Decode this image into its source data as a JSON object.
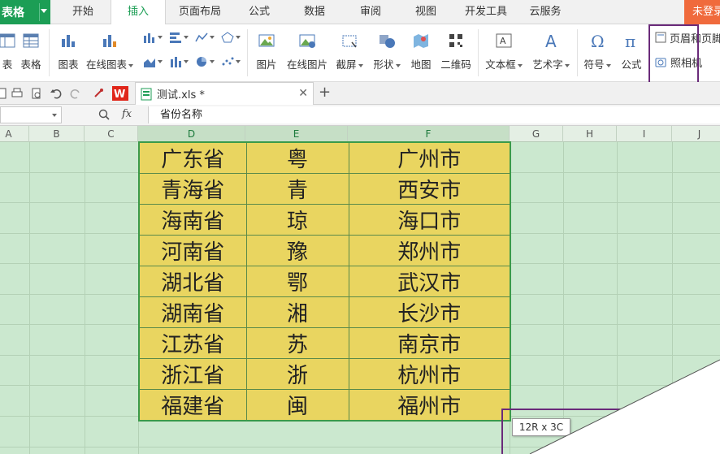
{
  "app": {
    "name": "表格",
    "login": "未登录"
  },
  "menu_tabs": [
    {
      "label": "开始"
    },
    {
      "label": "插入"
    },
    {
      "label": "页面布局"
    },
    {
      "label": "公式"
    },
    {
      "label": "数据"
    },
    {
      "label": "审阅"
    },
    {
      "label": "视图"
    },
    {
      "label": "开发工具"
    },
    {
      "label": "云服务"
    }
  ],
  "active_tab": "插入",
  "ribbon": {
    "pivot_table": "表",
    "table": "表格",
    "chart": "图表",
    "online_chart": "在线图表",
    "picture": "图片",
    "online_picture": "在线图片",
    "screenshot": "截屏",
    "shapes": "形状",
    "map": "地图",
    "qrcode": "二维码",
    "textbox": "文本框",
    "wordart": "艺术字",
    "symbol": "符号",
    "equation": "公式",
    "header_footer": "页眉和页脚",
    "camera": "照相机"
  },
  "file_tab": {
    "name": "测试.xls *"
  },
  "formula_bar": {
    "fx": "fx",
    "content": "省份名称"
  },
  "columns": [
    "A",
    "B",
    "C",
    "D",
    "E",
    "F",
    "G",
    "H",
    "I",
    "J"
  ],
  "selected_columns": [
    "D",
    "E",
    "F"
  ],
  "table_rows": [
    [
      "广东省",
      "粤",
      "广州市"
    ],
    [
      "青海省",
      "青",
      "西安市"
    ],
    [
      "海南省",
      "琼",
      "海口市"
    ],
    [
      "河南省",
      "豫",
      "郑州市"
    ],
    [
      "湖北省",
      "鄂",
      "武汉市"
    ],
    [
      "湖南省",
      "湘",
      "长沙市"
    ],
    [
      "江苏省",
      "苏",
      "南京市"
    ],
    [
      "浙江省",
      "浙",
      "杭州市"
    ],
    [
      "福建省",
      "闽",
      "福州市"
    ]
  ],
  "selection_tooltip": "12R x 3C",
  "colors": {
    "accent": "#1c9e55",
    "highlight_box": "#6a2b7a",
    "cell_fill": "#e9d560",
    "sheet_bg": "#cbe8cf"
  }
}
